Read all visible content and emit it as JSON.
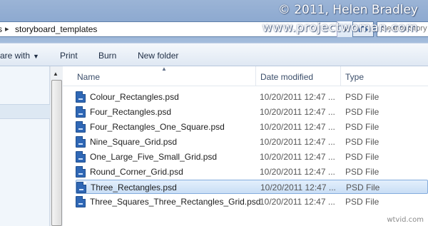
{
  "address": {
    "prev_segment_partial": "s",
    "separator": "▸",
    "current_folder": "storyboard_templates",
    "search_placeholder": "Search Story"
  },
  "watermark": {
    "line1": "© 2011, Helen Bradley",
    "line2": "www.projectwoman.com"
  },
  "toolbar": {
    "share_label": "are with",
    "print_label": "Print",
    "burn_label": "Burn",
    "new_folder_label": "New folder"
  },
  "columns": {
    "name": "Name",
    "date_modified": "Date modified",
    "type": "Type"
  },
  "files": [
    {
      "name": "Colour_Rectangles.psd",
      "date": "10/20/2011 12:47 ...",
      "type": "PSD File",
      "selected": false
    },
    {
      "name": "Four_Rectangles.psd",
      "date": "10/20/2011 12:47 ...",
      "type": "PSD File",
      "selected": false
    },
    {
      "name": "Four_Rectangles_One_Square.psd",
      "date": "10/20/2011 12:47 ...",
      "type": "PSD File",
      "selected": false
    },
    {
      "name": "Nine_Square_Grid.psd",
      "date": "10/20/2011 12:47 ...",
      "type": "PSD File",
      "selected": false
    },
    {
      "name": "One_Large_Five_Small_Grid.psd",
      "date": "10/20/2011 12:47 ...",
      "type": "PSD File",
      "selected": false
    },
    {
      "name": "Round_Corner_Grid.psd",
      "date": "10/20/2011 12:47 ...",
      "type": "PSD File",
      "selected": false
    },
    {
      "name": "Three_Rectangles.psd",
      "date": "10/20/2011 12:47 ...",
      "type": "PSD File",
      "selected": true
    },
    {
      "name": "Three_Squares_Three_Rectangles_Grid.psd",
      "date": "10/20/2011 12:47 ...",
      "type": "PSD File",
      "selected": false
    }
  ],
  "icons": {
    "file_icon": "psd-file-icon",
    "dropdown_icon": "chevron-down-icon",
    "sort_icon": "sort-ascending-icon",
    "refresh_icon": "refresh-icon"
  },
  "colors": {
    "title_bar": "#8aa7cf",
    "selection": "#c9def5",
    "selection_border": "#84acdd"
  },
  "corner_watermark": "wtvid.com"
}
